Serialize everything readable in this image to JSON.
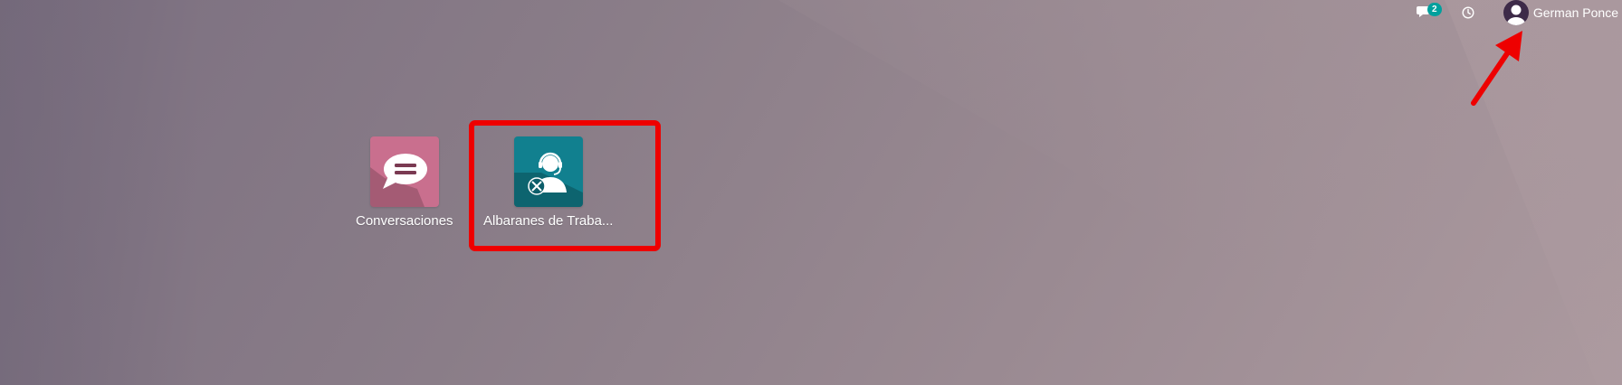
{
  "topbar": {
    "messages_badge": "2",
    "user_name": "German Ponce",
    "icons": [
      "chat-icon",
      "clock-icon",
      "user-avatar"
    ]
  },
  "apps": [
    {
      "label": "Conversaciones",
      "icon": "speech-bubble-icon",
      "color": "#c96f8e"
    },
    {
      "label": "Albaranes de Traba...",
      "icon": "support-agent-icon",
      "color": "#11808f"
    }
  ],
  "annotations": {
    "highlight_color": "#ee0000",
    "arrow_color": "#ee0000"
  }
}
